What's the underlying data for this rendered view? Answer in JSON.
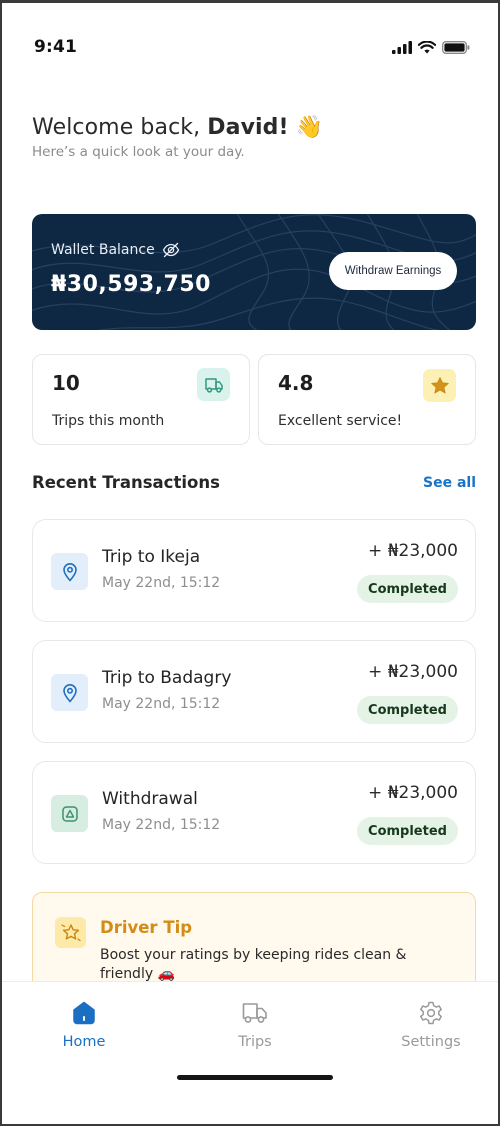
{
  "status_bar": {
    "time": "9:41"
  },
  "greeting": {
    "welcome": "Welcome back, ",
    "name": "David!",
    "emoji": "👋",
    "subtitle": "Here’s a quick look at your day."
  },
  "wallet": {
    "label": "Wallet Balance",
    "amount": "₦30,593,750",
    "withdraw_label": "Withdraw Earnings",
    "hidden_icon": "eye-off-icon"
  },
  "stats": [
    {
      "value": "10",
      "caption": "Trips this month",
      "icon": "truck-icon",
      "badge_color": "#d9f3ec",
      "icon_color": "#2e9a7f"
    },
    {
      "value": "4.8",
      "caption": "Excellent service!",
      "icon": "star-icon",
      "badge_color": "#fdf0b5",
      "icon_color": "#d4931a"
    }
  ],
  "recent": {
    "title": "Recent Transactions",
    "see_all": "See all",
    "items": [
      {
        "title": "Trip to Ikeja",
        "date": "May 22nd, 15:12",
        "amount": "+ ₦23,000",
        "status": "Completed",
        "icon": "location-pin-icon"
      },
      {
        "title": "Trip to Badagry",
        "date": "May 22nd, 15:12",
        "amount": "+ ₦23,000",
        "status": "Completed",
        "icon": "location-pin-icon"
      },
      {
        "title": "Withdrawal",
        "date": "May 22nd, 15:12",
        "amount": "+ ₦23,000",
        "status": "Completed",
        "icon": "withdrawal-icon"
      }
    ]
  },
  "tip": {
    "title": "Driver Tip",
    "body": "Boost your ratings by keeping rides clean & friendly 🚗",
    "icon": "sparkle-star-icon"
  },
  "tabs": [
    {
      "label": "Home",
      "icon": "home-icon",
      "active": true
    },
    {
      "label": "Trips",
      "icon": "truck-icon",
      "active": false
    },
    {
      "label": "Settings",
      "icon": "gear-icon",
      "active": false
    }
  ],
  "colors": {
    "accent": "#1a6fc2",
    "wallet_bg": "#0e2743",
    "completed_bg": "#e4f3e6",
    "tip_title": "#d38c16"
  }
}
